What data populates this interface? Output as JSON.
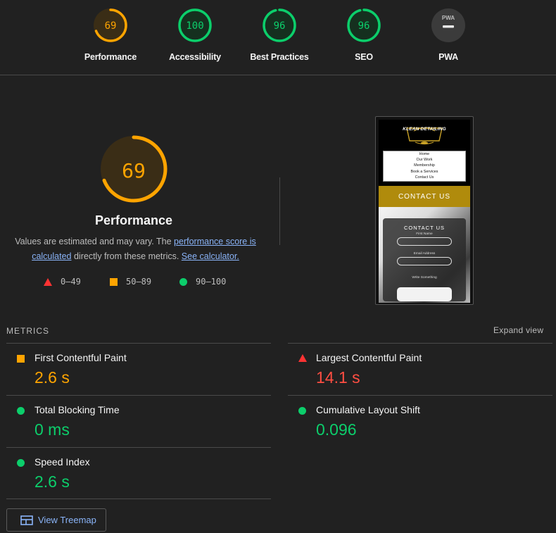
{
  "colors": {
    "pass": "#0cce6b",
    "average": "#ffa400",
    "fail": "#ff4e42",
    "na": "#9e9e9e",
    "link": "#8ab4f8"
  },
  "gauges": [
    {
      "label": "Performance",
      "score": 69,
      "display": "69",
      "color": "#ffa400"
    },
    {
      "label": "Accessibility",
      "score": 100,
      "display": "100",
      "color": "#0cce6b"
    },
    {
      "label": "Best Practices",
      "score": 96,
      "display": "96",
      "color": "#0cce6b"
    },
    {
      "label": "SEO",
      "score": 96,
      "display": "96",
      "color": "#0cce6b"
    },
    {
      "label": "PWA",
      "score": null,
      "display": "PWA",
      "color": "#9e9e9e",
      "icon": "dash-icon"
    }
  ],
  "performance": {
    "score": 69,
    "display": "69",
    "title": "Performance",
    "desc_prefix": "Values are estimated and may vary. The ",
    "desc_link1": "performance score is calculated",
    "desc_middle": " directly from these metrics. ",
    "desc_link2": "See calculator."
  },
  "legend": [
    {
      "range": "0–49",
      "shape": "triangle"
    },
    {
      "range": "50–89",
      "shape": "square"
    },
    {
      "range": "90–100",
      "shape": "circle"
    }
  ],
  "thumbnail": {
    "logo_text": "KLEAN DETAILING",
    "menu": [
      "Home",
      "Our Work",
      "Membership",
      "Book a Services",
      "Contact Us"
    ],
    "band": "CONTACT US",
    "form_title": "CONTACT US",
    "fields": [
      "First Name",
      "Email Address",
      "Write Something"
    ]
  },
  "metrics": {
    "heading": "METRICS",
    "expand": "Expand view",
    "items": [
      {
        "name": "First Contentful Paint",
        "value": "2.6 s",
        "status": "average"
      },
      {
        "name": "Largest Contentful Paint",
        "value": "14.1 s",
        "status": "fail"
      },
      {
        "name": "Total Blocking Time",
        "value": "0 ms",
        "status": "pass"
      },
      {
        "name": "Cumulative Layout Shift",
        "value": "0.096",
        "status": "pass"
      },
      {
        "name": "Speed Index",
        "value": "2.6 s",
        "status": "pass"
      }
    ]
  },
  "treemap": {
    "label": "View Treemap"
  }
}
